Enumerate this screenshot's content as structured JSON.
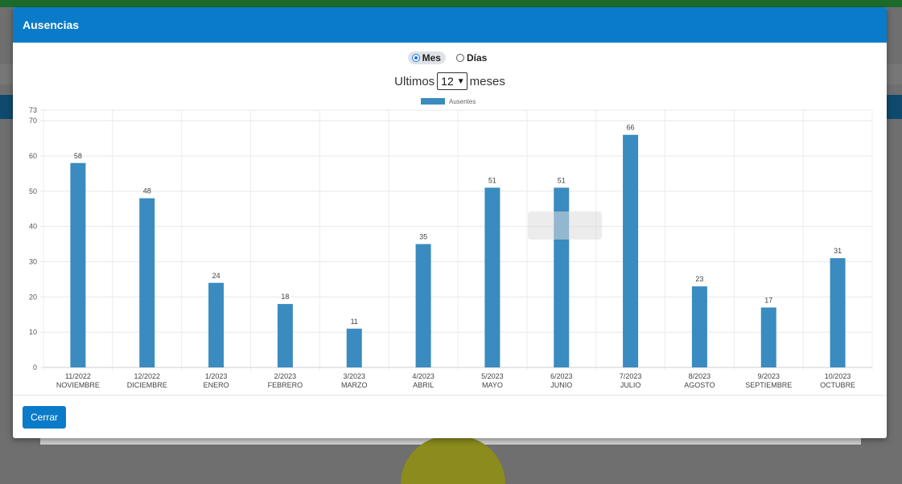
{
  "modal": {
    "title": "Ausencias",
    "close_label": "Cerrar"
  },
  "filter": {
    "mode_options": [
      {
        "label": "Mes",
        "checked": true
      },
      {
        "label": "Días",
        "checked": false
      }
    ],
    "prefix": "Ultimos",
    "months_value": "12",
    "suffix": "meses"
  },
  "chart_data": {
    "type": "bar",
    "categories": [
      [
        "11/2022",
        "NOVIEMBRE"
      ],
      [
        "12/2022",
        "DICIEMBRE"
      ],
      [
        "1/2023",
        "ENERO"
      ],
      [
        "2/2023",
        "FEBRERO"
      ],
      [
        "3/2023",
        "MARZO"
      ],
      [
        "4/2023",
        "ABRIL"
      ],
      [
        "5/2023",
        "MAYO"
      ],
      [
        "6/2023",
        "JUNIO"
      ],
      [
        "7/2023",
        "JULIO"
      ],
      [
        "8/2023",
        "AGOSTO"
      ],
      [
        "9/2023",
        "SEPTIEMBRE"
      ],
      [
        "10/2023",
        "OCTUBRE"
      ]
    ],
    "series": [
      {
        "name": "Ausentes",
        "color": "#3a8bbf",
        "values": [
          58,
          48,
          24,
          18,
          11,
          35,
          51,
          51,
          66,
          23,
          17,
          31
        ]
      }
    ],
    "ylim": [
      0,
      73
    ],
    "yticks": [
      0,
      10,
      20,
      30,
      40,
      50,
      60,
      70,
      73
    ],
    "grid": true,
    "legend_position": "top-center",
    "data_labels": true
  }
}
